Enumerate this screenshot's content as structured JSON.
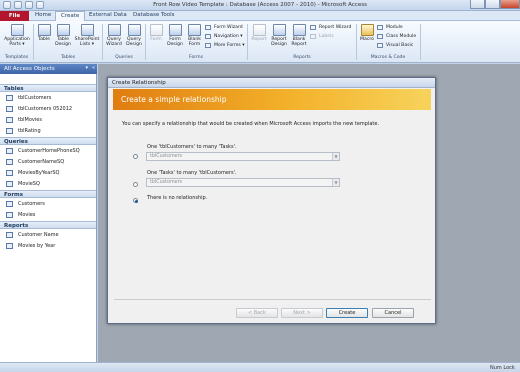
{
  "app": {
    "title": "Front Row Video Template : Database (Access 2007 - 2010) - Microsoft Access",
    "tabs": [
      "File",
      "Home",
      "Create",
      "External Data",
      "Database Tools"
    ],
    "active_tab": "Create"
  },
  "ribbon": {
    "templates": {
      "application_parts": "Application Parts ▾",
      "label": "Templates"
    },
    "tables": {
      "table": "Table",
      "table_design": "Table Design",
      "sharepoint_lists": "SharePoint Lists ▾",
      "label": "Tables"
    },
    "queries": {
      "query_wizard": "Query Wizard",
      "query_design": "Query Design",
      "label": "Queries"
    },
    "forms": {
      "form": "Form",
      "form_design": "Form Design",
      "blank_form": "Blank Form",
      "form_wizard": "Form Wizard",
      "navigation": "Navigation ▾",
      "more_forms": "More Forms ▾",
      "label": "Forms"
    },
    "reports": {
      "report": "Report",
      "report_design": "Report Design",
      "blank_report": "Blank Report",
      "report_wizard": "Report Wizard",
      "labels": "Labels",
      "label": "Reports"
    },
    "macros": {
      "macro": "Macro",
      "module": "Module",
      "class_module": "Class Module",
      "visual_basic": "Visual Basic",
      "label": "Macros & Code"
    }
  },
  "nav_pane": {
    "header": "All Access Objects",
    "sections": [
      {
        "name": "Tables",
        "items": [
          "tblCustomers",
          "tblCustomers 052012",
          "tblMovies",
          "tblRating"
        ]
      },
      {
        "name": "Queries",
        "items": [
          "CustomerHomePhoneSQ",
          "CustomerNameSQ",
          "MoviesByYearSQ",
          "MovieSQ"
        ]
      },
      {
        "name": "Forms",
        "items": [
          "Customers",
          "Movies"
        ]
      },
      {
        "name": "Reports",
        "items": [
          "Customer Name",
          "Movies by Year"
        ]
      }
    ]
  },
  "dialog": {
    "title": "Create Relationship",
    "header": "Create a simple relationship",
    "description": "You can specify a relationship that would be created when Microsoft Access imports the new template.",
    "option1": {
      "label": "One 'tblCustomers' to many 'Tasks'.",
      "select_value": "tblCustomers"
    },
    "option2": {
      "label": "One 'Tasks' to many 'tblCustomers'.",
      "select_value": "tblCustomers"
    },
    "option3": {
      "label": "There is no relationship."
    },
    "selected_option": 3,
    "buttons": {
      "back": "< Back",
      "next": "Next >",
      "create": "Create",
      "cancel": "Cancel"
    }
  },
  "status": {
    "num_lock": "Num Lock"
  },
  "colors": {
    "file_tab": "#b3162c",
    "header_gradient_start": "#e07d10",
    "header_gradient_end": "#f7d35c",
    "nav_header": "#3d65a6"
  }
}
